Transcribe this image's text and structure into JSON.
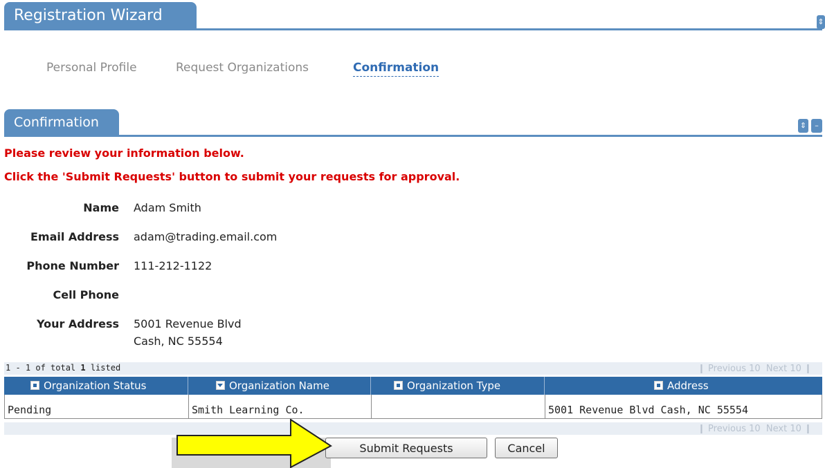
{
  "wizard": {
    "title": "Registration Wizard",
    "steps": [
      {
        "label": "Personal Profile",
        "state": "complete"
      },
      {
        "label": "Request Organizations",
        "state": "complete"
      },
      {
        "label": "Confirmation",
        "state": "active"
      }
    ]
  },
  "confirmation": {
    "title": "Confirmation",
    "warning1": "Please review your information below.",
    "warning2": "Click the 'Submit Requests' button to submit your requests for approval.",
    "fields": [
      {
        "label": "Name",
        "value": "Adam Smith"
      },
      {
        "label": "Email Address",
        "value": "adam@trading.email.com"
      },
      {
        "label": "Phone Number",
        "value": "111-212-1122"
      },
      {
        "label": "Cell Phone",
        "value": ""
      },
      {
        "label": "Your Address",
        "value": "5001 Revenue Blvd",
        "value2": "Cash, NC 55554"
      }
    ]
  },
  "grid": {
    "summary_prefix": "1 - 1 of total ",
    "summary_total": "1",
    "summary_suffix": " listed",
    "prev": "Previous 10",
    "next": "Next 10",
    "columns": [
      "Organization Status",
      "Organization Name",
      "Organization Type",
      "Address"
    ],
    "rows": [
      {
        "status": "Pending",
        "name": "Smith Learning Co.",
        "type": "",
        "address": "5001 Revenue Blvd Cash, NC 55554"
      }
    ]
  },
  "actions": {
    "submit": "Submit Requests",
    "cancel": "Cancel"
  },
  "colors": {
    "header_blue": "#5b8ec0",
    "grid_header": "#2f6aa6",
    "warning_red": "#d90000",
    "active_step": "#2f6bb3",
    "arrow_yellow": "#ffff00"
  },
  "icons": {
    "collapse": "updown-icon",
    "minimize": "minus-icon",
    "pointer": "yellow-arrow-annotation"
  }
}
